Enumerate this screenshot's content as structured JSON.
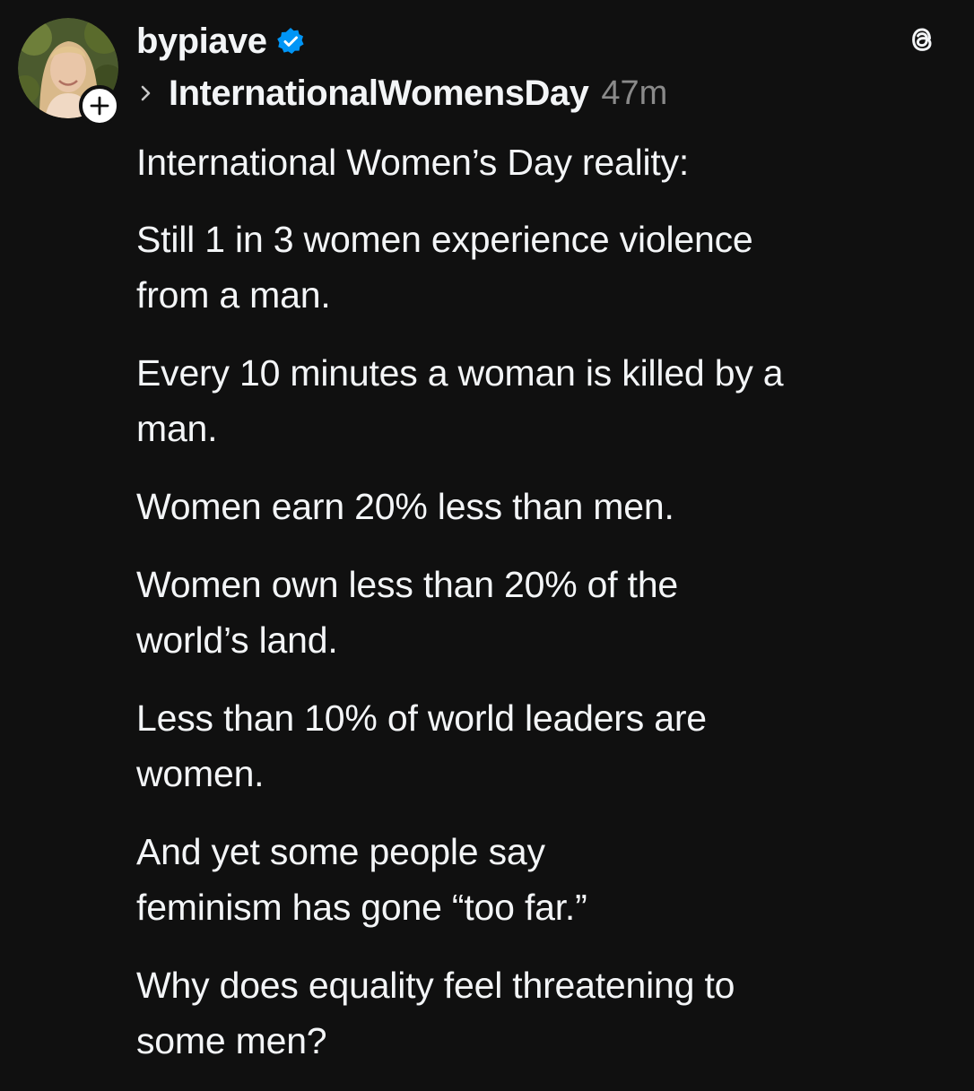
{
  "post": {
    "author": {
      "username": "bypiave",
      "verified": true,
      "avatar_icon": "profile-photo-icon",
      "follow_icon": "plus-icon"
    },
    "topic": "InternationalWomensDay",
    "timestamp": "47m",
    "app_icon": "threads-logo-icon",
    "paragraphs": [
      [
        "International Women’s Day reality:"
      ],
      [
        "Still 1 in 3 women experience violence",
        "from a man."
      ],
      [
        "Every 10 minutes a woman is killed by a",
        "man."
      ],
      [
        "Women earn 20% less than men."
      ],
      [
        "Women own less than 20% of the",
        "world’s land."
      ],
      [
        "Less than 10% of world leaders are",
        "women."
      ],
      [
        "And yet some people say",
        "feminism has gone “too far.”"
      ],
      [
        "Why does equality feel threatening to",
        "some men?"
      ]
    ]
  },
  "colors": {
    "background": "#101010",
    "text": "#f3f5f7",
    "muted": "#8a8a8a",
    "verified_blue": "#0095f6"
  }
}
